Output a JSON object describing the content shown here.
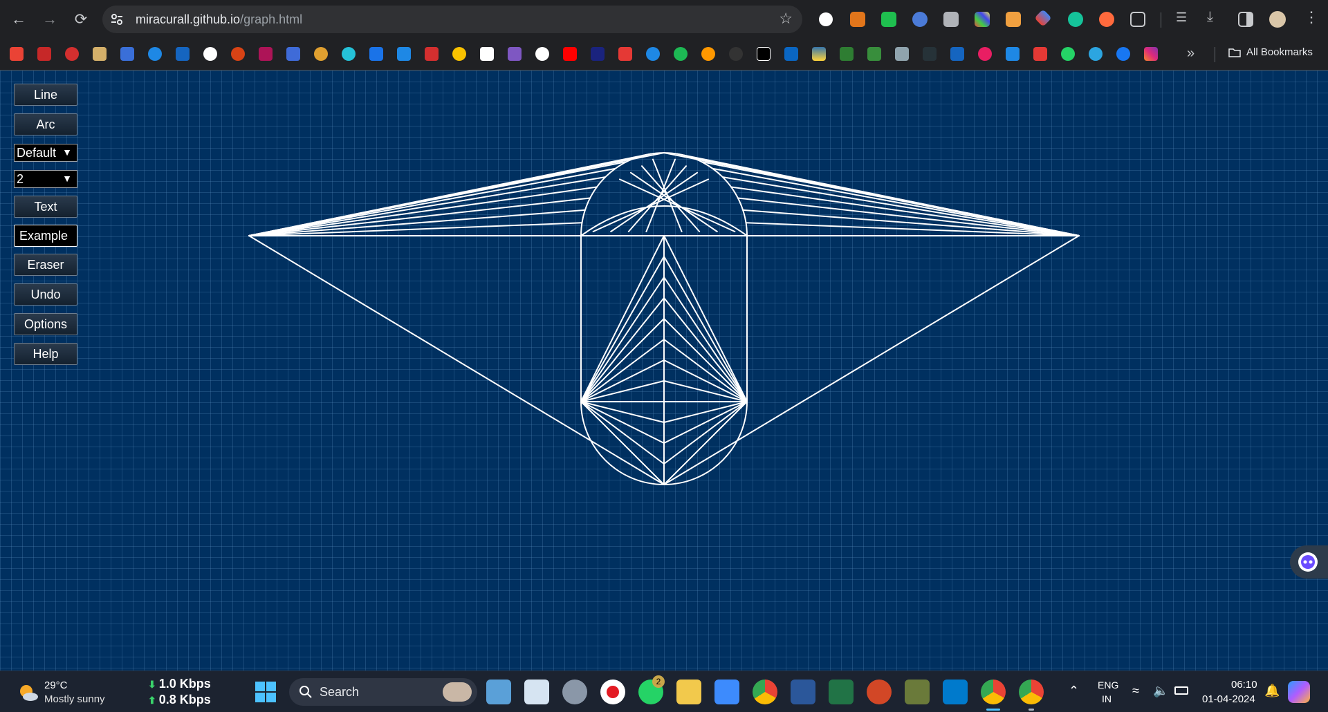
{
  "browser": {
    "url_host": "miracurall.github.io",
    "url_path": "/graph.html",
    "all_bookmarks_label": "All Bookmarks"
  },
  "toolbar": {
    "line_label": "Line",
    "arc_label": "Arc",
    "style_select": "Default",
    "width_select": "2",
    "text_label": "Text",
    "example_label": "Example",
    "eraser_label": "Eraser",
    "undo_label": "Undo",
    "options_label": "Options",
    "help_label": "Help"
  },
  "taskbar": {
    "weather_temp": "29°C",
    "weather_desc": "Mostly sunny",
    "net_down": "1.0 Kbps",
    "net_up": "0.8 Kbps",
    "search_label": "Search",
    "whatsapp_badge": "2",
    "lang_line1": "ENG",
    "lang_line2": "IN",
    "time": "06:10",
    "date": "01-04-2024"
  },
  "colors": {
    "canvas_bg": "#003060",
    "grid": "#5a8cbe",
    "stroke": "#ffffff",
    "chrome_bg": "#202124",
    "taskbar_bg": "#1c2330"
  },
  "icons": {
    "back": "arrow-left-icon",
    "forward": "arrow-right-icon",
    "reload": "reload-icon",
    "bookmark_star": "star-icon",
    "menu": "kebab-menu-icon",
    "folder": "folder-icon",
    "windows_start": "windows-logo-icon",
    "search": "search-icon"
  }
}
